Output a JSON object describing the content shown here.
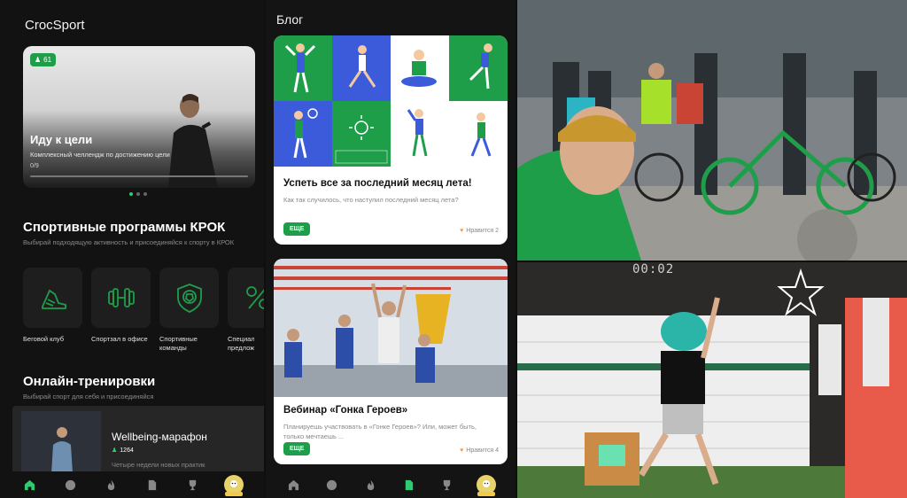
{
  "screen1": {
    "app_title": "CrocSport",
    "hero": {
      "badge": "61",
      "title": "Иду к цели",
      "subtitle": "Комплексный челлендж по достижению цели",
      "progress": "0/9",
      "progress_value": 0
    },
    "programs": {
      "title": "Спортивные программы КРОК",
      "subtitle": "Выбирай подходящую активность и присоединяйся к спорту в КРОК",
      "items": [
        {
          "label": "Беговой клуб",
          "icon": "running-shoe-icon"
        },
        {
          "label": "Спортзал в офисе",
          "icon": "dumbbell-icon"
        },
        {
          "label": "Спортивные команды",
          "icon": "ball-shield-icon"
        },
        {
          "label": "Специальные предложения",
          "icon": "percent-icon"
        }
      ]
    },
    "online": {
      "title": "Онлайн-тренировки",
      "subtitle": "Выбирай спорт для себя и присоединяйся",
      "card": {
        "title": "Wellbeing-марафон",
        "count": "1264",
        "description": "Четыре недели новых практик"
      }
    }
  },
  "screen2": {
    "title": "Блог",
    "posts": [
      {
        "title": "Успеть все за последний месяц лета!",
        "text": "Как так случилось, что наступил последний месяц лета?",
        "button": "ЕЩЕ",
        "likes": "Нравится 2"
      },
      {
        "title": "Вебинар «Гонка Героев»",
        "text": "Планируешь участвовать в «Гонке Героев»? Или, может быть, только мечтаешь ...",
        "button": "ЕЩЕ",
        "likes": "Нравится 4"
      }
    ]
  },
  "photo_bottom": {
    "timer": "00:02"
  },
  "colors": {
    "accent": "#1f9e4a",
    "background": "#121212",
    "tile": "#1e1e1e",
    "blog_blue": "#3b5bdb",
    "blog_green": "#1f9e4a"
  }
}
